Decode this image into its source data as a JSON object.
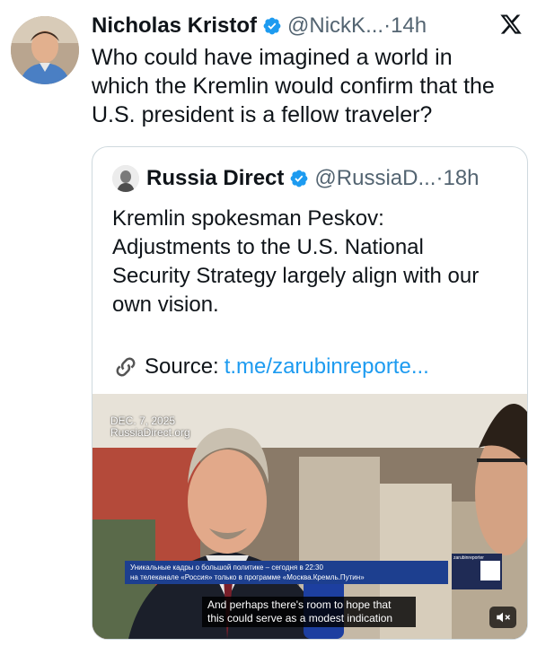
{
  "tweet": {
    "author_name": "Nicholas Kristof",
    "handle": "@NickK...",
    "dot": "·",
    "time": "14h",
    "text": "Who could have imagined a world in which the Kremlin would confirm that the U.S. president is a fellow traveler?"
  },
  "quoted": {
    "author_name": "Russia Direct",
    "handle": "@RussiaD...",
    "dot": "·",
    "time": "18h",
    "text": "Kremlin spokesman Peskov: Adjustments to the U.S. National Security Strategy largely align with our own vision.",
    "source_label": "Source:",
    "source_link": "t.me/zarubinreporte...",
    "media": {
      "date_stamp": "DEC. 7, 2025",
      "watermark": "RussiaDirect.org",
      "ticker_line1": "Уникальные кадры о большой политике – сегодня в 22:30",
      "ticker_line2": "на телеканале «Россия» только в программе «Москва.Кремль.Путин»",
      "ticker_tag": "zarubinreporter",
      "subtitle": "And perhaps there's room to hope that this could serve as a modest indication"
    }
  },
  "colors": {
    "accent": "#1d9bf0",
    "text": "#0f1419",
    "muted": "#536471",
    "border": "#cfd9de"
  },
  "icons": [
    "verified-badge-icon",
    "x-logo-icon",
    "link-icon",
    "mute-icon"
  ]
}
